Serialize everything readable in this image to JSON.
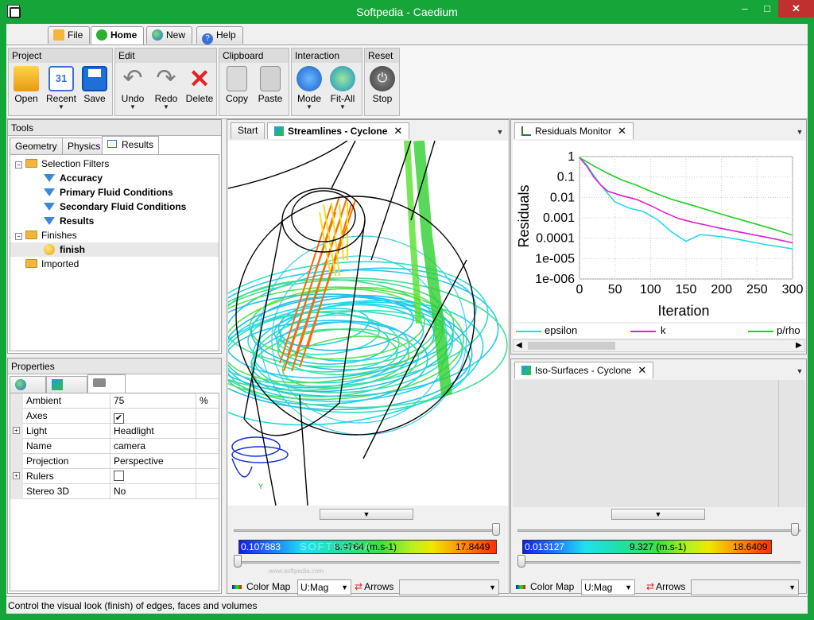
{
  "window": {
    "title": "Softpedia - Caedium",
    "minimize": "–",
    "maximize": "□",
    "close": "✕"
  },
  "menu_tabs": [
    {
      "label": "File",
      "icon": "folder-icon"
    },
    {
      "label": "Home",
      "icon": "home-icon"
    },
    {
      "label": "New",
      "icon": "globe-icon"
    },
    {
      "label": "Help",
      "icon": "help-icon"
    }
  ],
  "ribbon": {
    "groups": [
      {
        "title": "Project",
        "buttons": [
          "Open",
          "Recent",
          "Save"
        ]
      },
      {
        "title": "Edit",
        "buttons": [
          "Undo",
          "Redo",
          "Delete"
        ]
      },
      {
        "title": "Clipboard",
        "buttons": [
          "Copy",
          "Paste"
        ]
      },
      {
        "title": "Interaction",
        "buttons": [
          "Mode",
          "Fit-All"
        ]
      },
      {
        "title": "Reset",
        "buttons": [
          "Stop"
        ]
      }
    ],
    "calendar_day": "31"
  },
  "tools": {
    "title": "Tools",
    "tabs": [
      "Geometry",
      "Physics",
      "Results"
    ],
    "tree": {
      "selection_filters": "Selection Filters",
      "filters": [
        "Accuracy",
        "Primary Fluid Conditions",
        "Secondary Fluid Conditions",
        "Results"
      ],
      "finishes": "Finishes",
      "finish_item": "finish",
      "imported": "Imported"
    }
  },
  "properties": {
    "title": "Properties",
    "rows": [
      {
        "name": "Ambient",
        "value": "75",
        "unit": "%"
      },
      {
        "name": "Axes",
        "value": "✔",
        "unit": ""
      },
      {
        "name": "Light",
        "value": "Headlight",
        "unit": ""
      },
      {
        "name": "Name",
        "value": "camera",
        "unit": ""
      },
      {
        "name": "Projection",
        "value": "Perspective",
        "unit": ""
      },
      {
        "name": "Rulers",
        "value": "",
        "unit": ""
      },
      {
        "name": "Stereo 3D",
        "value": "No",
        "unit": ""
      }
    ],
    "expanders": [
      "+",
      "+"
    ]
  },
  "viewer_left": {
    "tabs": [
      "Start",
      "Streamlines - Cyclone"
    ],
    "cmap_min": "0.107883",
    "cmap_mid": "8.9764 (m.s-1)",
    "cmap_max": "17.8449",
    "colormap_label": "Color Map",
    "colormap_value": "U:Mag",
    "arrows_label": "Arrows",
    "watermark": "SOFTPEDIA",
    "watermark_url": "www.softpedia.com",
    "axes_tag": "Y"
  },
  "residuals": {
    "tab": "Residuals Monitor",
    "legend": [
      "epsilon",
      "k",
      "p/rho"
    ]
  },
  "viewer_right": {
    "tab": "Iso-Surfaces - Cyclone",
    "cmap_min": "0.013127",
    "cmap_mid": "9.327 (m.s-1)",
    "cmap_max": "18.6409",
    "colormap_label": "Color Map",
    "colormap_value": "U:Mag",
    "arrows_label": "Arrows"
  },
  "status": "Control the visual look (finish) of edges, faces and volumes",
  "chart_data": {
    "type": "line",
    "title": "",
    "xlabel": "Iteration",
    "ylabel": "Residuals",
    "xlim": [
      0,
      300
    ],
    "ylim": [
      1e-06,
      1
    ],
    "yscale": "log",
    "xticks": [
      "0",
      "50",
      "100",
      "150",
      "200",
      "250",
      "300"
    ],
    "yticks": [
      "1",
      "0.1",
      "0.01",
      "0.001",
      "0.0001",
      "1e-005",
      "1e-006"
    ],
    "grid": true,
    "legend": "bottom",
    "series": [
      {
        "name": "epsilon",
        "color": "#22d8f0",
        "x": [
          0,
          10,
          20,
          30,
          40,
          50,
          70,
          90,
          110,
          130,
          150,
          170,
          200,
          230,
          260,
          300
        ],
        "y": [
          0.9,
          0.4,
          0.12,
          0.04,
          0.015,
          0.006,
          0.003,
          0.002,
          0.0008,
          0.0002,
          7e-05,
          0.00015,
          0.00012,
          8e-05,
          5e-05,
          3e-05
        ]
      },
      {
        "name": "k",
        "color": "#e020d0",
        "x": [
          0,
          10,
          20,
          30,
          40,
          60,
          80,
          100,
          120,
          140,
          160,
          200,
          240,
          270,
          300
        ],
        "y": [
          0.9,
          0.35,
          0.1,
          0.04,
          0.02,
          0.012,
          0.008,
          0.004,
          0.0018,
          0.0009,
          0.0006,
          0.0003,
          0.00016,
          0.0001,
          6e-05
        ]
      },
      {
        "name": "p/rho",
        "color": "#20d020",
        "x": [
          0,
          20,
          40,
          60,
          80,
          100,
          130,
          160,
          200,
          240,
          270,
          300
        ],
        "y": [
          0.9,
          0.35,
          0.15,
          0.07,
          0.04,
          0.02,
          0.008,
          0.004,
          0.0015,
          0.0006,
          0.0003,
          0.00014
        ]
      }
    ]
  }
}
